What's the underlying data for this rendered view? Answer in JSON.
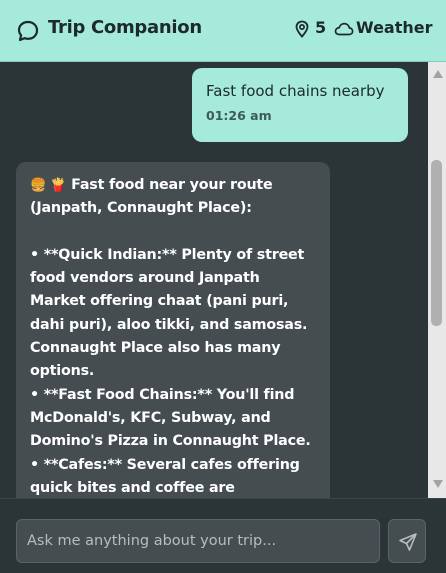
{
  "header": {
    "title": "Trip Companion",
    "location_count": "5",
    "weather_label": "Weather",
    "icons": [
      "chat-bubble-icon",
      "map-pin-icon",
      "cloud-icon"
    ]
  },
  "messages": {
    "user": {
      "text": "Fast food chains nearby",
      "time": "01:26 am"
    },
    "bot": {
      "emojis": "🍔 🍟",
      "lines": [
        "Fast food near your route",
        "(Janpath, Connaught Place):",
        "",
        "• **Quick Indian:**  Plenty of street",
        "food vendors around Janpath",
        "Market offering chaat (pani puri,",
        "dahi puri), aloo tikki, and samosas.",
        "Connaught Place also has many",
        "options.",
        "• **Fast Food Chains:** You'll find",
        "McDonald's, KFC, Subway, and",
        "Domino's Pizza in Connaught Place.",
        "• **Cafes:**  Several cafes offering",
        "quick bites and coffee are"
      ]
    }
  },
  "composer": {
    "placeholder": "Ask me anything about your trip...",
    "send_icon": "send-icon"
  },
  "colors": {
    "accent": "#a6eadb",
    "background": "#2b3437",
    "bot_bubble": "#454d51"
  }
}
